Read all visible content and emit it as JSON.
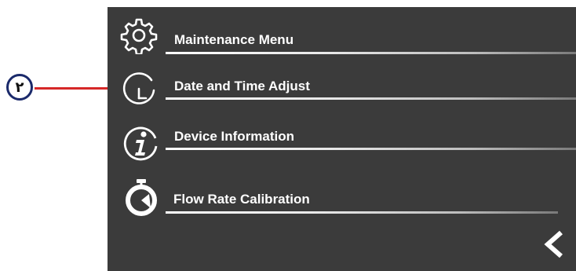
{
  "callout": {
    "number": "٢"
  },
  "menu": {
    "items": [
      {
        "label": "Maintenance Menu",
        "icon": "gear-icon"
      },
      {
        "label": "Date and Time Adjust",
        "icon": "clock-icon"
      },
      {
        "label": "Device Information",
        "icon": "info-icon"
      },
      {
        "label": "Flow Rate Calibration",
        "icon": "stopwatch-icon"
      }
    ],
    "back_icon": "chevron-left-icon"
  },
  "colors": {
    "screen_background": "#3b3b3b",
    "text": "#ffffff",
    "callout_line": "#d62828",
    "callout_border": "#1b2a6b"
  }
}
